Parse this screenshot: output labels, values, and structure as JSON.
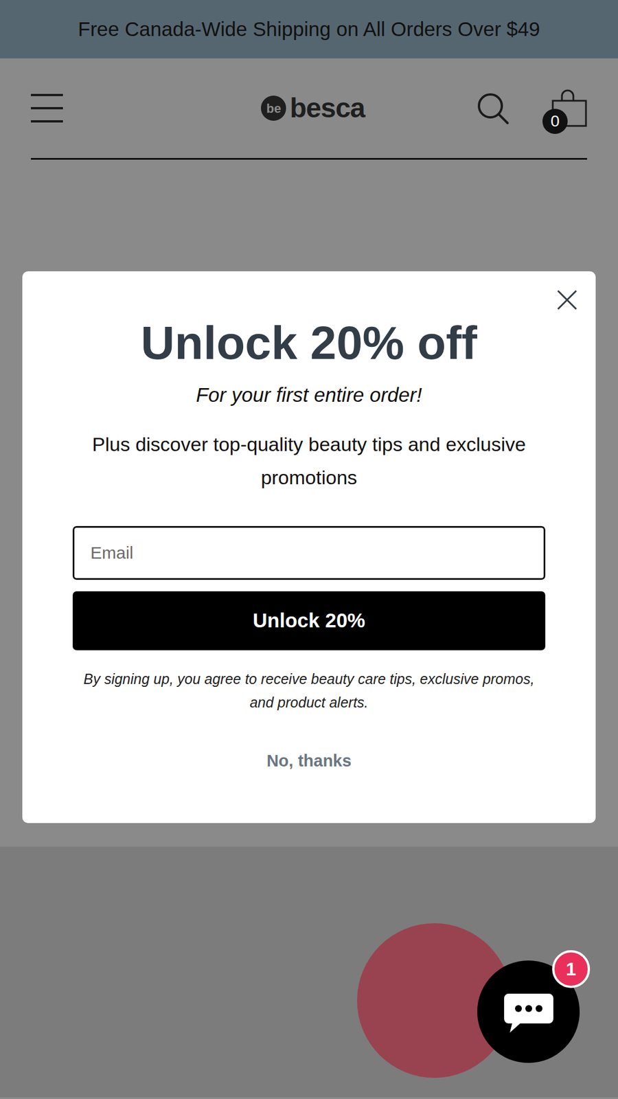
{
  "banner": {
    "text": "Free Canada-Wide Shipping on All Orders Over $49"
  },
  "header": {
    "logo": {
      "mark": "be",
      "name": "besca"
    },
    "cart_count": "0"
  },
  "popup": {
    "title": "Unlock 20% off",
    "subtitle": "For your first entire order!",
    "description": "Plus discover top-quality beauty tips and exclusive promotions",
    "email": {
      "placeholder": "Email",
      "value": ""
    },
    "submit": "Unlock 20%",
    "disclaimer": "By signing up, you agree to receive beauty care tips, exclusive promos, and product alerts.",
    "decline": "No, thanks"
  },
  "chat": {
    "unread": "1"
  }
}
